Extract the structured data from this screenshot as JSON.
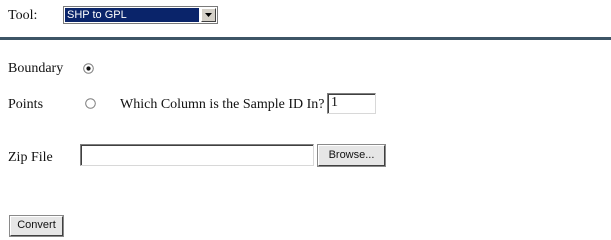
{
  "tool": {
    "label": "Tool:",
    "selected_value": "SHP to GPL"
  },
  "shape_type": {
    "boundary_label": "Boundary",
    "boundary_selected": true,
    "points_label": "Points",
    "points_selected": false
  },
  "sample_id": {
    "question": "Which Column is the Sample ID In?",
    "value": "1"
  },
  "zip_file": {
    "label": "Zip File",
    "value": "",
    "browse_label": "Browse..."
  },
  "actions": {
    "convert_label": "Convert"
  },
  "colors": {
    "divider": "#3d5566",
    "select_highlight": "#0a246a"
  }
}
